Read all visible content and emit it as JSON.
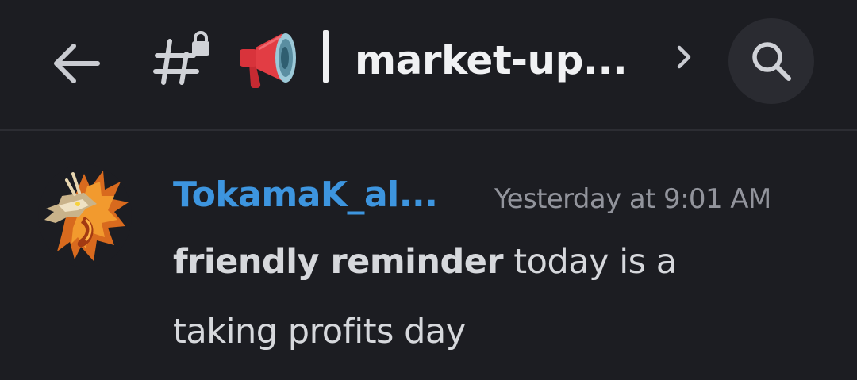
{
  "header": {
    "back_icon": "arrow-left-icon",
    "channel_type_icon": "locked-hash-channel-icon",
    "channel_emoji": "📢",
    "separator": "|",
    "channel_name": "market-up...",
    "chevron_icon": "chevron-right-icon",
    "search_icon": "search-icon"
  },
  "message": {
    "avatar_icon": "dragon-avatar-icon",
    "author": "TokamaK_al...",
    "timestamp": "Yesterday at 9:01 AM",
    "bold_text": "friendly reminder",
    "text_rest": " today is a",
    "text_line2": "taking profits day"
  },
  "colors": {
    "background": "#1c1d22",
    "author": "#3d95df",
    "timestamp": "#92949c",
    "text": "#d6d8dc",
    "search_circle": "#2a2b31"
  }
}
